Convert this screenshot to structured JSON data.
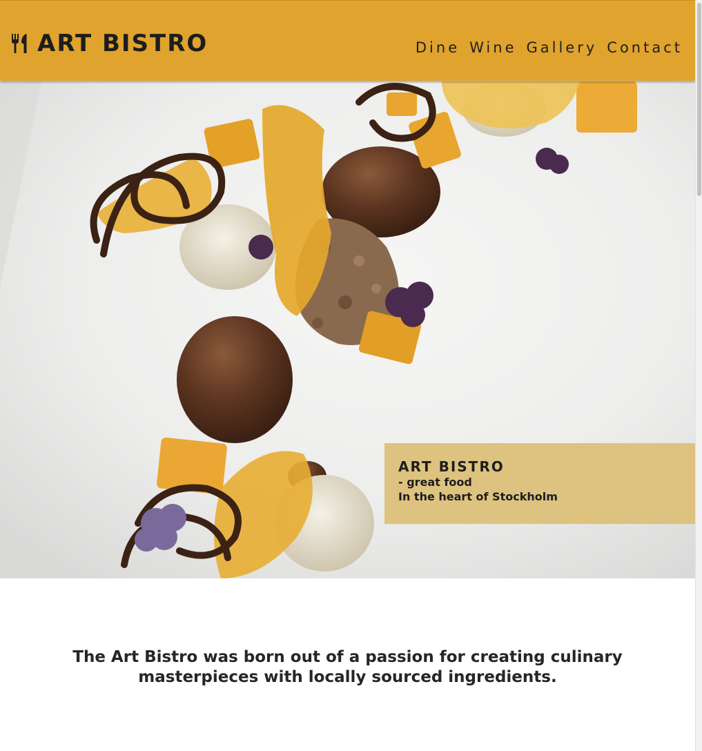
{
  "header": {
    "brand_name": "ART BISTRO",
    "brand_icon": "fork-knife-icon",
    "nav": [
      {
        "label": "Dine"
      },
      {
        "label": "Wine"
      },
      {
        "label": "Gallery"
      },
      {
        "label": "Contact"
      }
    ]
  },
  "hero": {
    "caption_title": "ART BISTRO",
    "caption_line1": "- great food",
    "caption_line2": "In the heart of Stockholm"
  },
  "intro": {
    "text": "The Art Bistro was born out of a passion for creating culinary masterpieces with locally sourced ingredients."
  },
  "colors": {
    "header_bg": "#e0a32e",
    "caption_bg": "#ddbe76",
    "text_dark": "#1e1e1e"
  }
}
